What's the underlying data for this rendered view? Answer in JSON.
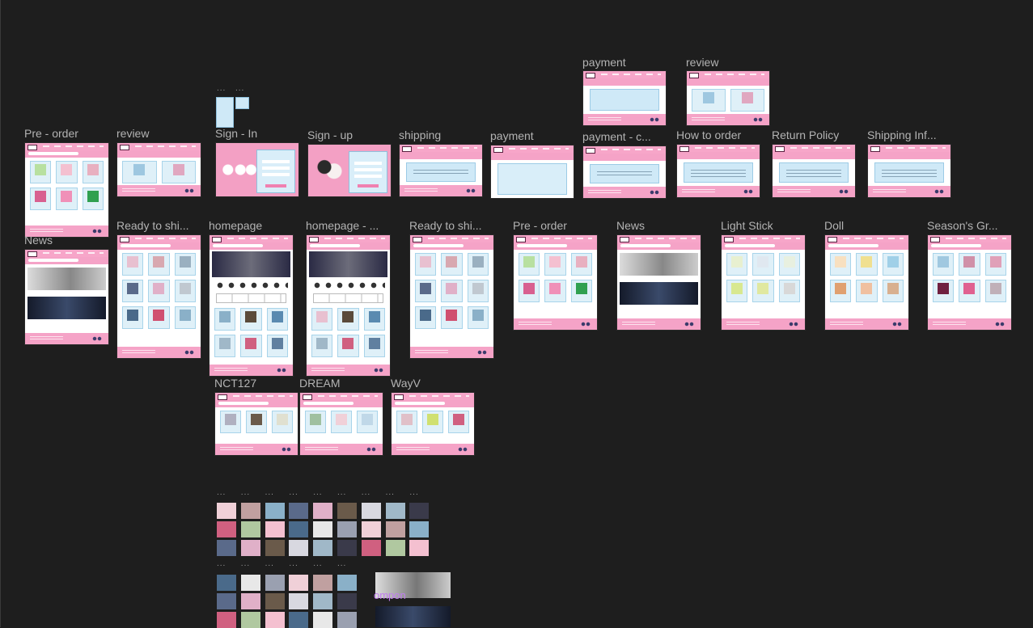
{
  "canvas": {
    "background": "#1e1e1e",
    "frame_pink": "#f5a3c7",
    "accent_blue": "#cfe9f7",
    "label_color": "#b3b3b3"
  },
  "frames": {
    "payment_top": "payment",
    "review_top": "review",
    "preorder_1": "Pre - order",
    "review_1": "review",
    "sign_in": "Sign - In",
    "sign_up": "Sign - up",
    "shipping": "shipping",
    "payment": "payment",
    "payment_c": "payment - c...",
    "how_to_order": "How to order",
    "return_policy": "Return Policy",
    "shipping_info": "Shipping Inf...",
    "news_1": "News",
    "ready_1": "Ready to shi...",
    "homepage": "homepage",
    "homepage_2": "homepage - ...",
    "ready_2": "Ready to shi...",
    "preorder_2": "Pre - order",
    "news_2": "News",
    "light_stick": "Light Stick",
    "doll": "Doll",
    "seasons": "Season's Gr...",
    "nct127": "NCT127",
    "dream": "DREAM",
    "wayv": "WayV"
  },
  "component_label": "ompon",
  "dots": "..."
}
